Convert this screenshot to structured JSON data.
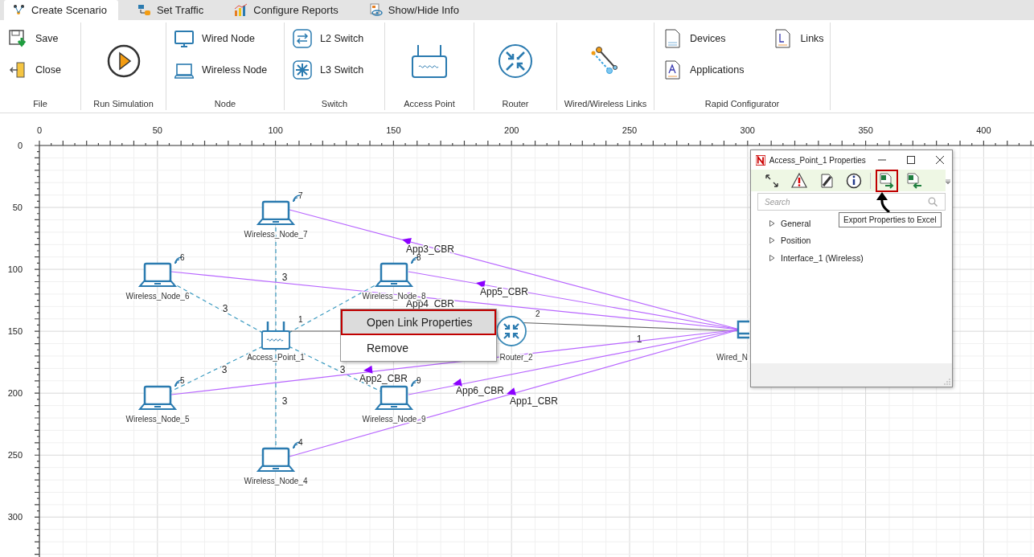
{
  "tabs": [
    {
      "label": "Create Scenario",
      "selected": true
    },
    {
      "label": "Set Traffic",
      "selected": false
    },
    {
      "label": "Configure Reports",
      "selected": false
    },
    {
      "label": "Show/Hide Info",
      "selected": false
    }
  ],
  "ribbon_groups": [
    {
      "label": "File",
      "kind": "list",
      "items": [
        {
          "label": "Save"
        },
        {
          "label": "Close"
        }
      ]
    },
    {
      "label": "Run Simulation",
      "kind": "large"
    },
    {
      "label": "Node",
      "kind": "list",
      "items": [
        {
          "label": "Wired Node"
        },
        {
          "label": "Wireless Node"
        }
      ]
    },
    {
      "label": "Switch",
      "kind": "list",
      "items": [
        {
          "label": "L2 Switch"
        },
        {
          "label": "L3 Switch"
        }
      ]
    },
    {
      "label": "Access Point",
      "kind": "large"
    },
    {
      "label": "Router",
      "kind": "large"
    },
    {
      "label": "Wired/Wireless Links",
      "kind": "large"
    },
    {
      "label": "Rapid Configurator",
      "kind": "list",
      "items": [
        {
          "label": "Devices"
        },
        {
          "label": "Applications"
        },
        {
          "label": "Links"
        }
      ]
    }
  ],
  "canvas": {
    "x_ticks": [
      "0",
      "50",
      "100",
      "150",
      "200",
      "250",
      "300",
      "350",
      "400"
    ],
    "y_ticks": [
      "0",
      "50",
      "100",
      "150",
      "200",
      "250",
      "300"
    ],
    "nodes": [
      {
        "kind": "wireless",
        "label": "Wireless_Node_7",
        "number": "7"
      },
      {
        "kind": "wireless",
        "label": "Wireless_Node_6",
        "number": "6"
      },
      {
        "kind": "wireless",
        "label": "Wireless_Node_8",
        "number": "8"
      },
      {
        "kind": "access_point",
        "label": "Access_Point_1",
        "number": "1"
      },
      {
        "kind": "router",
        "label": "Router_2",
        "number": "2"
      },
      {
        "kind": "wired",
        "label": "Wired_N"
      },
      {
        "kind": "wireless",
        "label": "Wireless_Node_5",
        "number": "5"
      },
      {
        "kind": "wireless",
        "label": "Wireless_Node_9",
        "number": "9"
      },
      {
        "kind": "wireless",
        "label": "Wireless_Node_4",
        "number": "4"
      }
    ],
    "links": [
      {
        "kind": "wireless",
        "label": "3"
      },
      {
        "kind": "wireless",
        "label": "3"
      },
      {
        "kind": "wireless"
      },
      {
        "kind": "wireless",
        "label": "3"
      },
      {
        "kind": "wireless",
        "label": "3"
      },
      {
        "kind": "wireless",
        "label": "3"
      },
      {
        "kind": "wired"
      },
      {
        "kind": "wired",
        "label": "1"
      }
    ],
    "applications": [
      {
        "label": "App3_CBR"
      },
      {
        "label": "App5_CBR"
      },
      {
        "label": "App4_CBR"
      },
      {
        "label": "App2_CBR"
      },
      {
        "label": "App6_CBR"
      },
      {
        "label": "App1_CBR"
      }
    ]
  },
  "context_menu": {
    "items": [
      {
        "label": "Open Link Properties",
        "selected": true
      },
      {
        "label": "Remove",
        "selected": false
      }
    ]
  },
  "properties_window": {
    "title": "Access_Point_1 Properties",
    "toolbar": [
      {
        "highlighted": false
      },
      {
        "highlighted": false
      },
      {
        "highlighted": false
      },
      {
        "highlighted": false
      },
      {
        "highlighted": true
      },
      {
        "highlighted": false
      }
    ],
    "search": {
      "placeholder": "Search"
    },
    "tooltip": "Export Properties to Excel",
    "tree": [
      {
        "label": "General",
        "expanded": false
      },
      {
        "label": "Position",
        "expanded": false
      },
      {
        "label": "Interface_1 (Wireless)",
        "expanded": false
      }
    ]
  }
}
